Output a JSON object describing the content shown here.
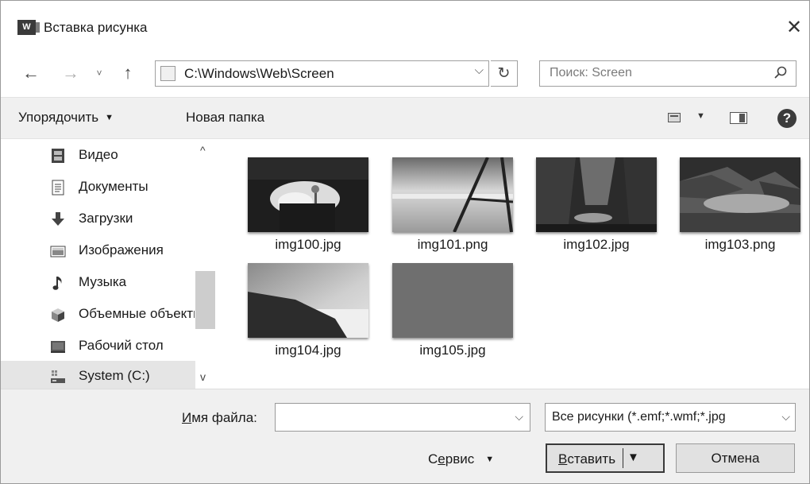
{
  "window": {
    "app_icon": "W",
    "title": "Вставка рисунка",
    "close_glyph": "✕"
  },
  "nav": {
    "back": "←",
    "forward": "→",
    "recent": "˅",
    "up": "↑"
  },
  "address": {
    "path": "C:\\Windows\\Web\\Screen",
    "dropdown": "⌵",
    "refresh": "↻"
  },
  "search": {
    "placeholder": "Поиск: Screen",
    "icon": "search-icon"
  },
  "toolbar": {
    "organize": "Упорядочить",
    "organize_caret": "▼",
    "new_folder": "Новая папка",
    "view_caret": "▼",
    "help": "?"
  },
  "sidebar": {
    "items": [
      {
        "label": "Видео",
        "icon": "video-icon"
      },
      {
        "label": "Документы",
        "icon": "documents-icon"
      },
      {
        "label": "Загрузки",
        "icon": "downloads-icon"
      },
      {
        "label": "Изображения",
        "icon": "pictures-icon"
      },
      {
        "label": "Музыка",
        "icon": "music-icon"
      },
      {
        "label": "Объемные объекты",
        "icon": "3d-objects-icon"
      },
      {
        "label": "Рабочий стол",
        "icon": "desktop-icon"
      },
      {
        "label": "System (C:)",
        "icon": "drive-icon",
        "selected": true
      }
    ],
    "scroll_up": "^",
    "scroll_down": "v"
  },
  "files": [
    {
      "name": "img100.jpg"
    },
    {
      "name": "img101.png"
    },
    {
      "name": "img102.jpg"
    },
    {
      "name": "img103.png"
    },
    {
      "name": "img104.jpg"
    },
    {
      "name": "img105.jpg"
    }
  ],
  "bottom": {
    "filename_label_u": "И",
    "filename_label_rest": "мя файла:",
    "filename_value": "",
    "filename_dd": "⌵",
    "filter": "Все рисунки (*.emf;*.wmf;*.jpg",
    "filter_dd": "⌵",
    "service_pre": "С",
    "service_u": "е",
    "service_post": "рвис",
    "service_caret": "▼",
    "insert_u": "В",
    "insert_rest": "ставить",
    "insert_dd": "▼",
    "cancel": "Отмена"
  }
}
